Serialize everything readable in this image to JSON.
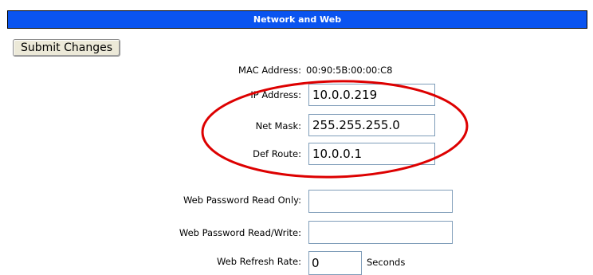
{
  "header": {
    "title": "Network and Web",
    "color": "#0a54f0"
  },
  "toolbar": {
    "submit_label": "Submit Changes"
  },
  "network": {
    "mac_label": "MAC Address:",
    "mac_value": "00:90:5B:00:00:C8",
    "ip_label": "IP Address:",
    "ip_value": "10.0.0.219",
    "mask_label": "Net Mask:",
    "mask_value": "255.255.255.0",
    "route_label": "Def Route:",
    "route_value": "10.0.0.1"
  },
  "web": {
    "pw_ro_label": "Web Password Read Only:",
    "pw_ro_value": "",
    "pw_rw_label": "Web Password Read/Write:",
    "pw_rw_value": "",
    "refresh_label": "Web Refresh Rate:",
    "refresh_value": "0",
    "refresh_unit": "Seconds"
  },
  "annotation": {
    "shape": "ellipse",
    "color": "#dd0000"
  }
}
